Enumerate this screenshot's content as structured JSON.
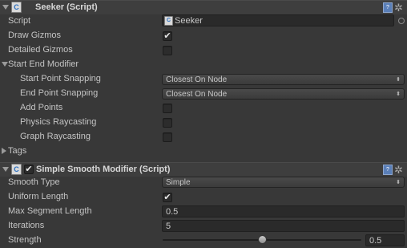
{
  "seeker": {
    "title": "Seeker (Script)",
    "fields": {
      "script_label": "Script",
      "script_value": "Seeker",
      "draw_gizmos_label": "Draw Gizmos",
      "draw_gizmos_checked": true,
      "detailed_gizmos_label": "Detailed Gizmos",
      "detailed_gizmos_checked": false
    },
    "start_end_modifier": {
      "label": "Start End Modifier",
      "start_point_snapping_label": "Start Point Snapping",
      "start_point_snapping_value": "Closest On Node",
      "end_point_snapping_label": "End Point Snapping",
      "end_point_snapping_value": "Closest On Node",
      "add_points_label": "Add Points",
      "add_points_checked": false,
      "physics_raycasting_label": "Physics Raycasting",
      "physics_raycasting_checked": false,
      "graph_raycasting_label": "Graph Raycasting",
      "graph_raycasting_checked": false
    },
    "tags_label": "Tags"
  },
  "simple_smooth": {
    "title": "Simple Smooth Modifier (Script)",
    "enabled": true,
    "smooth_type_label": "Smooth Type",
    "smooth_type_value": "Simple",
    "uniform_length_label": "Uniform Length",
    "uniform_length_checked": true,
    "max_segment_length_label": "Max Segment Length",
    "max_segment_length_value": "0.5",
    "iterations_label": "Iterations",
    "iterations_value": "5",
    "strength_label": "Strength",
    "strength_value": "0.5",
    "strength_fraction": 0.5
  },
  "glyphs": {
    "check": "✔",
    "dropdown_arrow": "⬍",
    "gear": "✲",
    "book": "?",
    "script_file": "C"
  }
}
